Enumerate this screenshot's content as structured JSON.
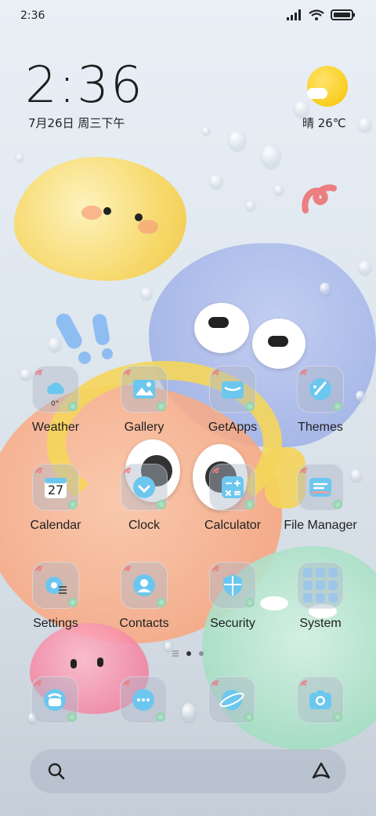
{
  "status_bar": {
    "time": "2:36"
  },
  "clock_widget": {
    "time": "2:36",
    "date": "7月26日 周三下午"
  },
  "weather_widget": {
    "text": "晴 26℃",
    "icon": "sun-cloud-icon"
  },
  "apps": [
    {
      "label": "Weather",
      "icon": "weather-icon",
      "detail": "0°"
    },
    {
      "label": "Gallery",
      "icon": "gallery-icon"
    },
    {
      "label": "GetApps",
      "icon": "getapps-icon"
    },
    {
      "label": "Themes",
      "icon": "themes-icon"
    },
    {
      "label": "Calendar",
      "icon": "calendar-icon",
      "detail": "27"
    },
    {
      "label": "Clock",
      "icon": "clock-icon"
    },
    {
      "label": "Calculator",
      "icon": "calculator-icon"
    },
    {
      "label": "File Manager",
      "icon": "file-manager-icon"
    },
    {
      "label": "Settings",
      "icon": "settings-icon"
    },
    {
      "label": "Contacts",
      "icon": "contacts-icon"
    },
    {
      "label": "Security",
      "icon": "security-icon"
    },
    {
      "label": "System",
      "icon": "system-folder-icon"
    }
  ],
  "dock": [
    {
      "icon": "phone-icon"
    },
    {
      "icon": "messages-icon"
    },
    {
      "icon": "browser-icon"
    },
    {
      "icon": "camera-icon"
    }
  ],
  "page_indicator": {
    "pages": 2,
    "active": 1
  },
  "colors": {
    "accent": "#6cc7ef",
    "text": "#1f1f1f"
  }
}
